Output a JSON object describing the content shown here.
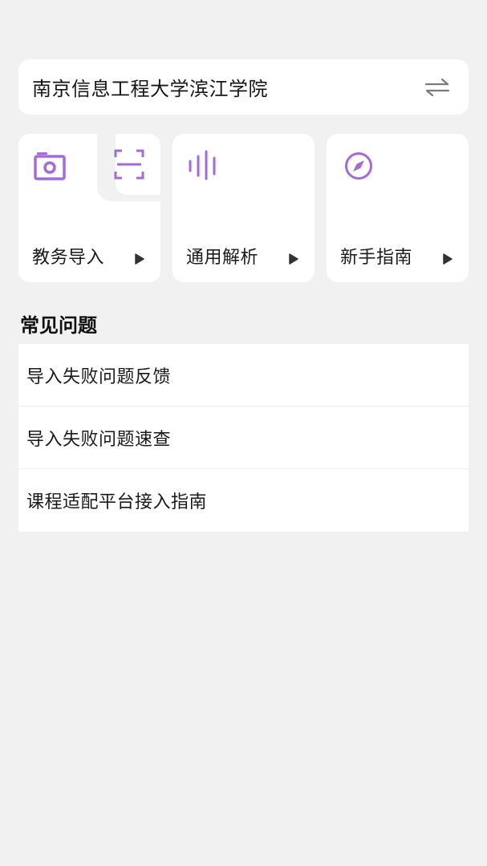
{
  "school": {
    "name": "南京信息工程大学滨江学院",
    "swap_icon": "swap-arrows-icon"
  },
  "cards": [
    {
      "label": "教务导入",
      "icons": [
        "camera-icon",
        "scan-icon"
      ]
    },
    {
      "label": "通用解析",
      "icons": [
        "voice-wave-icon"
      ]
    },
    {
      "label": "新手指南",
      "icons": [
        "compass-icon"
      ]
    }
  ],
  "faq": {
    "title": "常见问题",
    "items": [
      {
        "label": "导入失败问题反馈"
      },
      {
        "label": "导入失败问题速查"
      },
      {
        "label": "课程适配平台接入指南"
      }
    ]
  },
  "colors": {
    "accent": "#a46ad8",
    "background": "#f1f1f1",
    "card": "#ffffff"
  }
}
